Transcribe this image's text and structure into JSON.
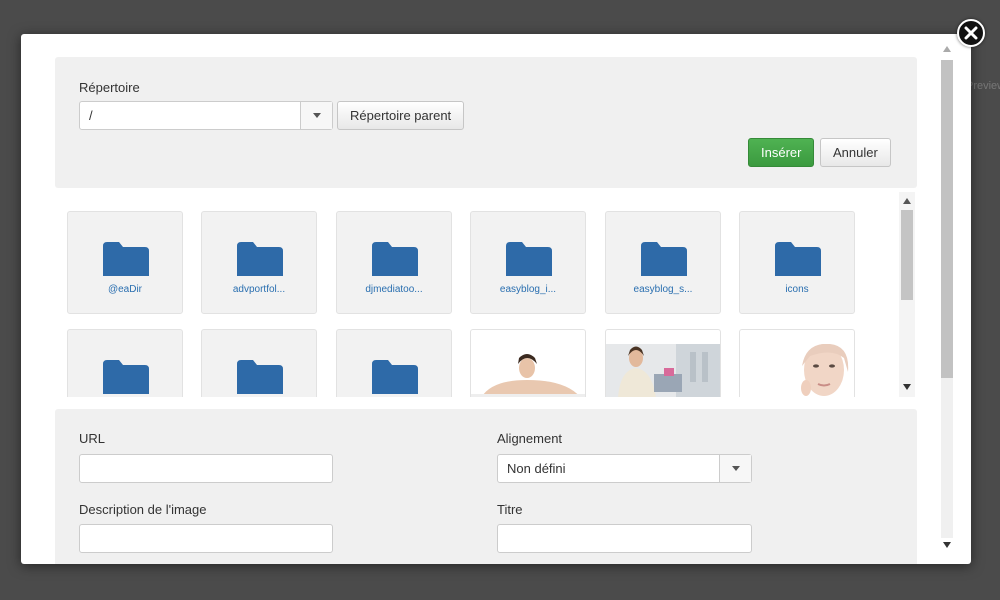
{
  "background": {
    "partial_text": "Preview"
  },
  "directory": {
    "label": "Répertoire",
    "selected": "/",
    "parent_button": "Répertoire parent"
  },
  "actions": {
    "insert": "Insérer",
    "cancel": "Annuler"
  },
  "items": [
    {
      "type": "folder",
      "name": "@eaDir"
    },
    {
      "type": "folder",
      "name": "advportfol..."
    },
    {
      "type": "folder",
      "name": "djmediatoo..."
    },
    {
      "type": "folder",
      "name": "easyblog_i..."
    },
    {
      "type": "folder",
      "name": "easyblog_s..."
    },
    {
      "type": "folder",
      "name": "icons"
    },
    {
      "type": "folder",
      "name": ""
    },
    {
      "type": "folder",
      "name": ""
    },
    {
      "type": "folder",
      "name": ""
    },
    {
      "type": "image",
      "name": ""
    },
    {
      "type": "image",
      "name": ""
    },
    {
      "type": "image",
      "name": ""
    }
  ],
  "form": {
    "url_label": "URL",
    "url_value": "",
    "alignment_label": "Alignement",
    "alignment_value": "Non défini",
    "description_label": "Description de l'image",
    "description_value": "",
    "title_label": "Titre",
    "title_value": ""
  },
  "colors": {
    "folder": "#2e6aa8",
    "insert_button": "#43a047",
    "overlay": "#4b4b4b"
  },
  "icons": [
    "close-icon",
    "chevron-down-icon",
    "folder-icon",
    "scroll-up-icon",
    "scroll-down-icon"
  ]
}
